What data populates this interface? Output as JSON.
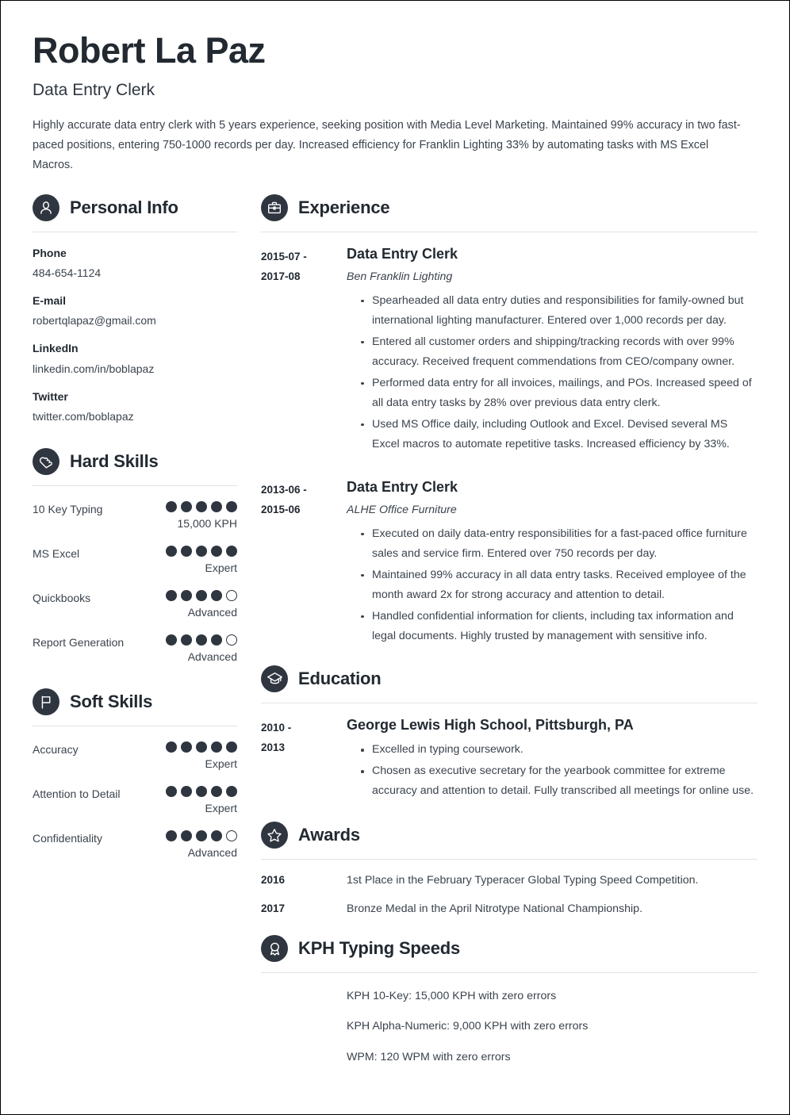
{
  "header": {
    "name": "Robert La Paz",
    "job_title": "Data Entry Clerk",
    "summary": "Highly accurate data entry clerk with 5 years experience, seeking position with Media Level Marketing. Maintained 99% accuracy in two fast-paced positions, entering 750-1000 records per day. Increased efficiency for Franklin Lighting 33% by automating tasks with MS Excel Macros."
  },
  "personal_info": {
    "section_title": "Personal Info",
    "icon": "person-icon",
    "fields": [
      {
        "label": "Phone",
        "value": "484-654-1124"
      },
      {
        "label": "E-mail",
        "value": "robertqlapaz@gmail.com"
      },
      {
        "label": "LinkedIn",
        "value": "linkedin.com/in/boblapaz"
      },
      {
        "label": "Twitter",
        "value": "twitter.com/boblapaz"
      }
    ]
  },
  "hard_skills": {
    "section_title": "Hard Skills",
    "icon": "puzzle-heart-icon",
    "items": [
      {
        "name": "10 Key Typing",
        "filled": 5,
        "total": 5,
        "level": "15,000 KPH"
      },
      {
        "name": "MS Excel",
        "filled": 5,
        "total": 5,
        "level": "Expert"
      },
      {
        "name": "Quickbooks",
        "filled": 4,
        "total": 5,
        "level": "Advanced"
      },
      {
        "name": "Report Generation",
        "filled": 4,
        "total": 5,
        "level": "Advanced"
      }
    ]
  },
  "soft_skills": {
    "section_title": "Soft Skills",
    "icon": "flag-icon",
    "items": [
      {
        "name": "Accuracy",
        "filled": 5,
        "total": 5,
        "level": "Expert"
      },
      {
        "name": "Attention to Detail",
        "filled": 5,
        "total": 5,
        "level": "Expert"
      },
      {
        "name": "Confidentiality",
        "filled": 4,
        "total": 5,
        "level": "Advanced"
      }
    ]
  },
  "experience": {
    "section_title": "Experience",
    "icon": "briefcase-icon",
    "entries": [
      {
        "date_from": "2015-07 -",
        "date_to": "2017-08",
        "title": "Data Entry Clerk",
        "company": "Ben Franklin Lighting",
        "bullets": [
          "Spearheaded all data entry duties and responsibilities for family-owned but international lighting manufacturer. Entered over 1,000 records per day.",
          "Entered all customer orders and shipping/tracking records with over 99% accuracy. Received frequent commendations from CEO/company owner.",
          "Performed data entry for all invoices, mailings, and POs. Increased speed of all data entry tasks by 28% over previous data entry clerk.",
          "Used MS Office daily, including Outlook and Excel. Devised several MS Excel macros to automate repetitive tasks. Increased efficiency by 33%."
        ]
      },
      {
        "date_from": "2013-06 -",
        "date_to": "2015-06",
        "title": "Data Entry Clerk",
        "company": "ALHE Office Furniture",
        "bullets": [
          "Executed on daily data-entry responsibilities for a fast-paced office furniture sales and service firm. Entered over 750 records per day.",
          "Maintained 99% accuracy in all data entry tasks. Received employee of the month award 2x for strong accuracy and attention to detail.",
          "Handled confidential information for clients, including tax information and legal documents. Highly trusted by management with sensitive info."
        ]
      }
    ]
  },
  "education": {
    "section_title": "Education",
    "icon": "graduation-cap-icon",
    "entries": [
      {
        "date_from": "2010 -",
        "date_to": "2013",
        "title": "George Lewis High School, Pittsburgh, PA",
        "bullets": [
          "Excelled in typing coursework.",
          "Chosen as executive secretary for the yearbook committee for extreme accuracy and attention to detail. Fully transcribed all meetings for online use."
        ]
      }
    ]
  },
  "awards": {
    "section_title": "Awards",
    "icon": "star-icon",
    "items": [
      {
        "year": "2016",
        "text": "1st Place in the February Typeracer Global Typing Speed Competition."
      },
      {
        "year": "2017",
        "text": "Bronze Medal in the April Nitrotype National Championship."
      }
    ]
  },
  "kph_typing_speeds": {
    "section_title": "KPH Typing Speeds",
    "icon": "award-ribbon-icon",
    "items": [
      "KPH 10-Key: 15,000 KPH with zero errors",
      "KPH Alpha-Numeric: 9,000 KPH with zero errors",
      "WPM: 120 WPM with zero errors"
    ]
  },
  "colors": {
    "ink": "#2f3640",
    "heading": "#222931",
    "body": "#3b434d",
    "rule": "#dfe2e6",
    "page_background": "#ffffff"
  }
}
